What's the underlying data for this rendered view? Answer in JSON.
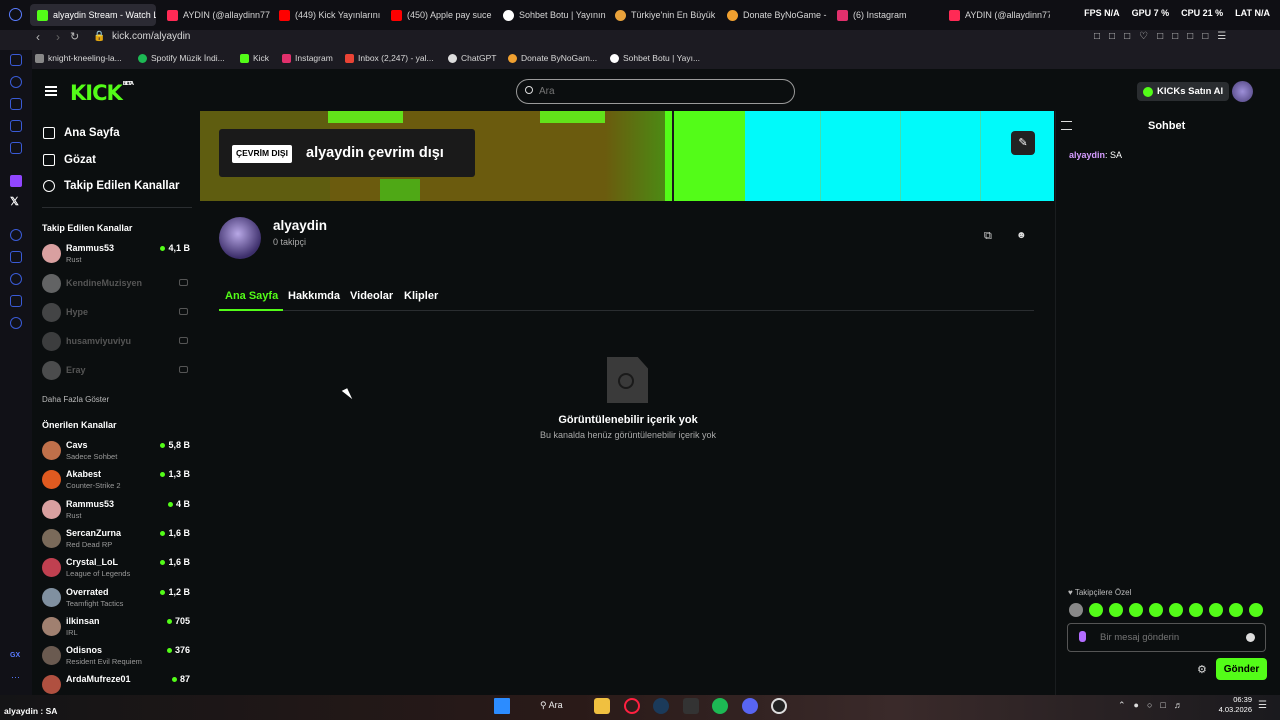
{
  "browser": {
    "tabs": [
      {
        "label": "alyaydin Stream - Watch L",
        "color": "#53fc18",
        "active": true
      },
      {
        "label": "AYDIN (@allaydinn77)",
        "color": "#ff2a55"
      },
      {
        "label": "(449) Kick Yayınlarını",
        "color": "#ff0000"
      },
      {
        "label": "(450) Apple pay suce",
        "color": "#ff0000"
      },
      {
        "label": "Sohbet Botu | Yayının",
        "color": "#ffffff"
      },
      {
        "label": "Türkiye'nin En Büyük",
        "color": "#e9a23b"
      },
      {
        "label": "Donate ByNoGame -",
        "color": "#f0a030"
      },
      {
        "label": "(6) Instagram",
        "color": "#e1306c"
      },
      {
        "label": "AYDIN (@allaydinn77)",
        "color": "#ff2a55"
      }
    ],
    "stats": {
      "fps": "FPS N/A",
      "gpu": "GPU 7 %",
      "cpu": "CPU 21 %",
      "lat": "LAT N/A"
    },
    "url": "kick.com/alyaydin",
    "bookmarks": [
      {
        "label": "knight-kneeling-la...",
        "color": "#888888"
      },
      {
        "label": "Spotify Müzik İndi...",
        "color": "#1db954"
      },
      {
        "label": "Kick",
        "color": "#53fc18"
      },
      {
        "label": "Instagram",
        "color": "#e1306c"
      },
      {
        "label": "Inbox (2,247) - yal...",
        "color": "#ea4335"
      },
      {
        "label": "ChatGPT",
        "color": "#dddddd"
      },
      {
        "label": "Donate ByNoGam...",
        "color": "#f0a030"
      },
      {
        "label": "Sohbet Botu | Yayı...",
        "color": "#ffffff"
      }
    ]
  },
  "header": {
    "logo": "KICK",
    "logo_beta": "BETA",
    "search_placeholder": "Ara",
    "buy_kicks": "KICKs Satın Al"
  },
  "left_nav": {
    "items": [
      {
        "label": "Ana Sayfa",
        "icon": "home-icon"
      },
      {
        "label": "Gözat",
        "icon": "browse-icon"
      },
      {
        "label": "Takip Edilen Kanallar",
        "icon": "heart-icon"
      }
    ],
    "followed_title": "Takip Edilen Kanallar",
    "followed": [
      {
        "name": "Rammus53",
        "game": "Rust",
        "viewers": "4,1 B",
        "online": true,
        "color": "#d9a0a0"
      },
      {
        "name": "KendineMuzisyen",
        "online": false,
        "color": "#cccccc"
      },
      {
        "name": "Hype",
        "online": false,
        "color": "#888888"
      },
      {
        "name": "husamviyuviyu",
        "online": false,
        "color": "#777777"
      },
      {
        "name": "Eray",
        "online": false,
        "color": "#999999"
      }
    ],
    "show_more": "Daha Fazla Göster",
    "recommended_title": "Önerilen Kanallar",
    "recommended": [
      {
        "name": "Cavs",
        "game": "Sadece Sohbet",
        "viewers": "5,8 B",
        "color": "#c0704a"
      },
      {
        "name": "Akabest",
        "game": "Counter-Strike 2",
        "viewers": "1,3 B",
        "color": "#e05a20"
      },
      {
        "name": "Rammus53",
        "game": "Rust",
        "viewers": "4 B",
        "color": "#d9a0a0"
      },
      {
        "name": "SercanZurna",
        "game": "Red Dead RP",
        "viewers": "1,6 B",
        "color": "#7a6a5a"
      },
      {
        "name": "Crystal_LoL",
        "game": "League of Legends",
        "viewers": "1,6 B",
        "color": "#c04050"
      },
      {
        "name": "Overrated",
        "game": "Teamfight Tactics",
        "viewers": "1,2 B",
        "color": "#8090a0"
      },
      {
        "name": "ilkinsan",
        "game": "IRL",
        "viewers": "705",
        "color": "#a08070"
      },
      {
        "name": "Odisnos",
        "game": "Resident Evil Requiem",
        "viewers": "376",
        "color": "#6a5a50"
      },
      {
        "name": "ArdaMufreze01",
        "game": "",
        "viewers": "87",
        "color": "#b05040"
      }
    ]
  },
  "channel": {
    "offline_badge": "ÇEVRİM DIŞI",
    "offline_text": "alyaydin çevrim dışı",
    "name": "alyaydin",
    "followers": "0 takipçi",
    "tabs": [
      "Ana Sayfa",
      "Hakkımda",
      "Videolar",
      "Klipler"
    ],
    "empty_title": "Görüntülenebilir içerik yok",
    "empty_subtitle": "Bu kanalda henüz görüntülenebilir içerik yok"
  },
  "chat": {
    "title": "Sohbet",
    "messages": [
      {
        "user": "alyaydin",
        "text": "SA"
      }
    ],
    "followers_only": "Takipçilere Özel",
    "input_placeholder": "Bir mesaj gönderin",
    "send": "Gönder"
  },
  "taskbar": {
    "status": "alyaydin : SA",
    "search": "Ara",
    "time": "06:39",
    "date": "4.03.2026"
  }
}
